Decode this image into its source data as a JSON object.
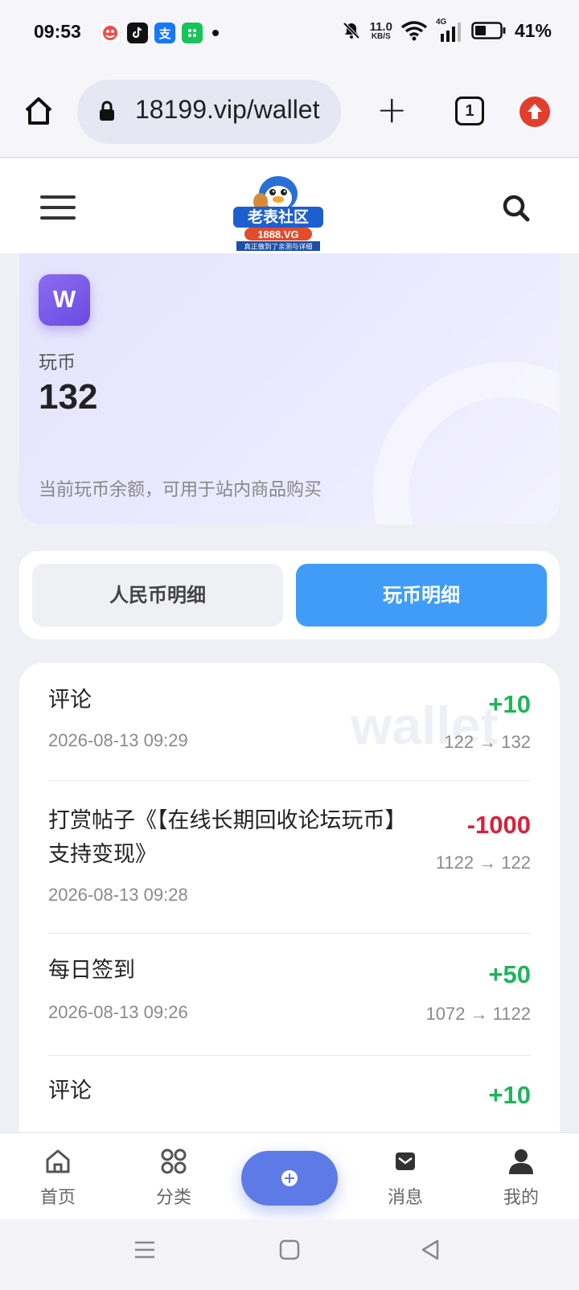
{
  "status_bar": {
    "time": "09:53",
    "net_speed_value": "11.0",
    "net_speed_unit": "KB/S",
    "signal_type": "4G",
    "battery": "41%",
    "app_icons": [
      "joke-app-icon",
      "tiktok-icon",
      "alipay-icon",
      "wechat-mini-icon"
    ]
  },
  "browser": {
    "url": "18199.vip/wallet",
    "tab_count": "1"
  },
  "site_header": {
    "logo_text": "老表社区",
    "logo_domain": "1888.VG",
    "logo_slogan": "真正做到了亲测与详细"
  },
  "balance": {
    "badge": "W",
    "label": "玩币",
    "value": "132",
    "note": "当前玩币余额，可用于站内商品购买"
  },
  "tabs": {
    "rmb": "人民币明细",
    "coin": "玩币明细",
    "active": "coin"
  },
  "records": {
    "watermark": "wallet",
    "items": [
      {
        "title": "评论",
        "time": "2026-08-13 09:29",
        "amount": "+10",
        "change": "122 → 132"
      },
      {
        "title": "打赏帖子《【在线长期回收论坛玩币】支持变现》",
        "time": "2026-08-13 09:28",
        "amount": "-1000",
        "change": "1122 → 122"
      },
      {
        "title": "每日签到",
        "time": "2026-08-13 09:26",
        "amount": "+50",
        "change": "1072 → 1122"
      },
      {
        "title": "评论",
        "time": "",
        "amount": "+10",
        "change": ""
      }
    ]
  },
  "bottom_nav": {
    "home": "首页",
    "category": "分类",
    "messages": "消息",
    "mine": "我的"
  },
  "colors": {
    "accent_blue": "#419cf8",
    "fab": "#5e7ae6",
    "positive": "#1fb45a",
    "negative": "#d9203b",
    "badge_purple": "#7b5cec"
  }
}
